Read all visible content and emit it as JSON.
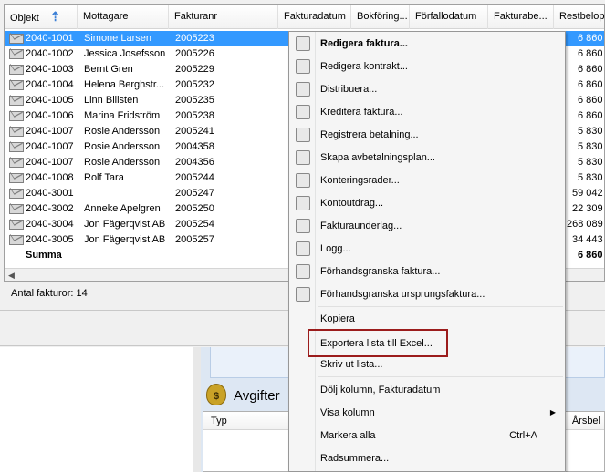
{
  "grid": {
    "columns": [
      "Objekt",
      "Mottagare",
      "Fakturanr",
      "Fakturadatum",
      "Bokföring...",
      "Förfallodatum",
      "Fakturabe...",
      "Restbelopp"
    ],
    "rows": [
      {
        "objekt": "2040-1001",
        "mottagare": "Simone Larsen",
        "fakturanr": "2005223",
        "rest": "6 860"
      },
      {
        "objekt": "2040-1002",
        "mottagare": "Jessica Josefsson",
        "fakturanr": "2005226",
        "rest": "6 860"
      },
      {
        "objekt": "2040-1003",
        "mottagare": "Bernt Gren",
        "fakturanr": "2005229",
        "rest": "6 860"
      },
      {
        "objekt": "2040-1004",
        "mottagare": "Helena Berghstr...",
        "fakturanr": "2005232",
        "rest": "6 860"
      },
      {
        "objekt": "2040-1005",
        "mottagare": "Linn Billsten",
        "fakturanr": "2005235",
        "rest": "6 860"
      },
      {
        "objekt": "2040-1006",
        "mottagare": "Marina Fridström",
        "fakturanr": "2005238",
        "rest": "6 860"
      },
      {
        "objekt": "2040-1007",
        "mottagare": "Rosie Andersson",
        "fakturanr": "2005241",
        "rest": "5 830"
      },
      {
        "objekt": "2040-1007",
        "mottagare": "Rosie Andersson",
        "fakturanr": "2004358",
        "rest": "5 830"
      },
      {
        "objekt": "2040-1007",
        "mottagare": "Rosie Andersson",
        "fakturanr": "2004356",
        "rest": "5 830"
      },
      {
        "objekt": "2040-1008",
        "mottagare": "Rolf Tara",
        "fakturanr": "2005244",
        "rest": "5 830"
      },
      {
        "objekt": "2040-3001",
        "mottagare": "",
        "fakturanr": "2005247",
        "rest": "59 042"
      },
      {
        "objekt": "2040-3002",
        "mottagare": "Anneke Apelgren",
        "fakturanr": "2005250",
        "rest": "22 309"
      },
      {
        "objekt": "2040-3004",
        "mottagare": "Jon Fägerqvist AB",
        "fakturanr": "2005254",
        "rest": "268 089"
      },
      {
        "objekt": "2040-3005",
        "mottagare": "Jon Fägerqvist AB",
        "fakturanr": "2005257",
        "rest": "34 443"
      }
    ],
    "summa_label": "Summa",
    "summa_value": "6 860"
  },
  "status": {
    "count_text": "Antal fakturor: 14"
  },
  "avgifter": {
    "title": "Avgifter",
    "col_typ": "Typ",
    "col_right": "Årsbel"
  },
  "menu": {
    "items": [
      "Redigera faktura...",
      "Redigera kontrakt...",
      "Distribuera...",
      "Kreditera faktura...",
      "Registrera betalning...",
      "Skapa avbetalningsplan...",
      "Konteringsrader...",
      "Kontoutdrag...",
      "Fakturaunderlag...",
      "Logg...",
      "Förhandsgranska faktura...",
      "Förhandsgranska ursprungsfaktura...",
      "Kopiera",
      "Exportera lista till Excel...",
      "Skriv ut lista...",
      "Dölj kolumn, Fakturadatum",
      "Visa kolumn",
      "Markera alla",
      "Radsummera..."
    ],
    "shortcut_markera": "Ctrl+A"
  }
}
